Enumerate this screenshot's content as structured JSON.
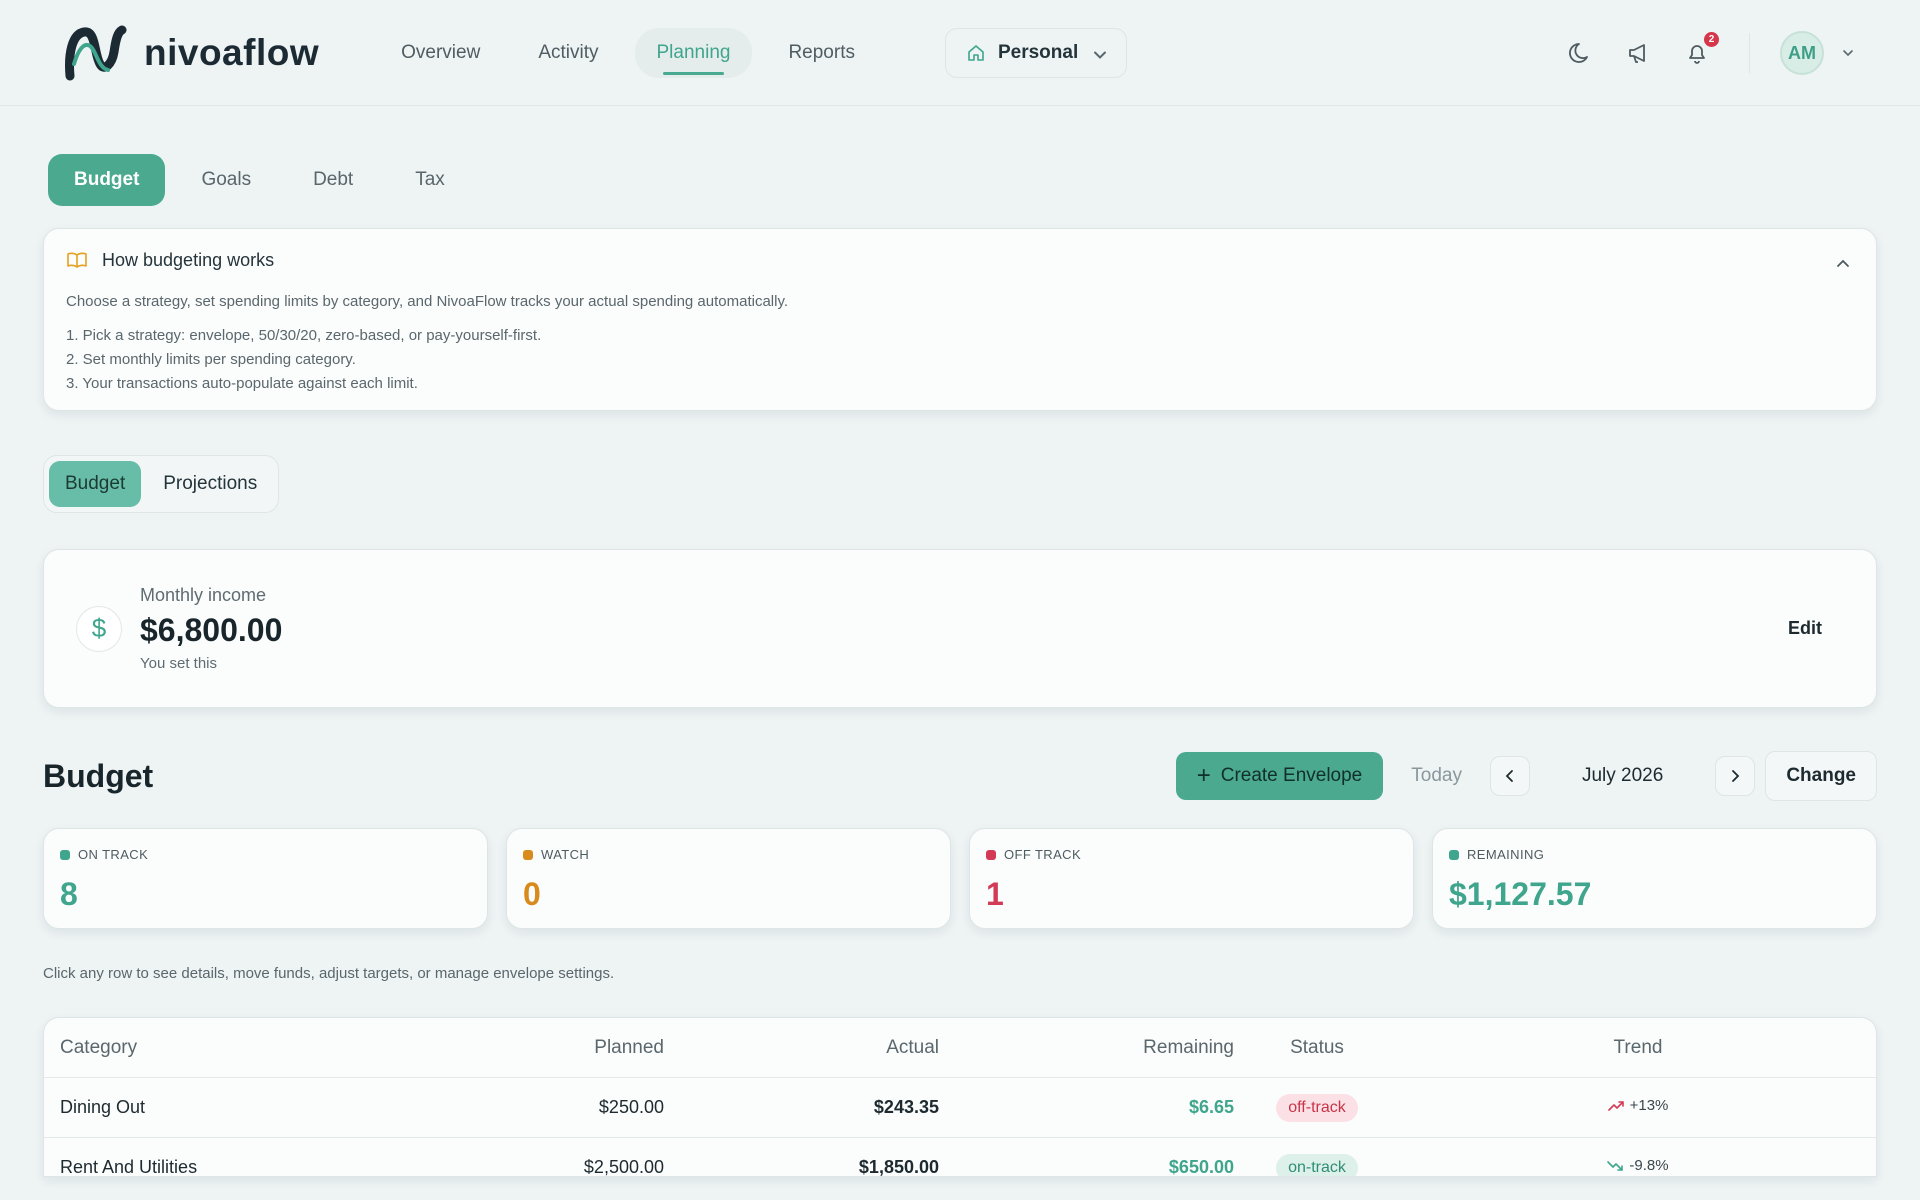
{
  "app": {
    "name": "nivoaflow"
  },
  "nav": {
    "items": [
      {
        "label": "Overview",
        "active": false
      },
      {
        "label": "Activity",
        "active": false
      },
      {
        "label": "Planning",
        "active": true
      },
      {
        "label": "Reports",
        "active": false
      }
    ]
  },
  "workspace": {
    "label": "Personal"
  },
  "header": {
    "notifications_count": "2",
    "avatar_initials": "AM"
  },
  "subtabs": [
    {
      "label": "Budget",
      "active": true
    },
    {
      "label": "Goals",
      "active": false
    },
    {
      "label": "Debt",
      "active": false
    },
    {
      "label": "Tax",
      "active": false
    }
  ],
  "howto": {
    "title": "How budgeting works",
    "description": "Choose a strategy, set spending limits by category, and NivoaFlow tracks your actual spending automatically.",
    "steps": [
      "1. Pick a strategy: envelope, 50/30/20, zero-based, or pay-yourself-first.",
      "2. Set monthly limits per spending category.",
      "3. Your transactions auto-populate against each limit."
    ]
  },
  "segment": {
    "items": [
      "Budget",
      "Projections"
    ],
    "active_index": 0
  },
  "income": {
    "label": "Monthly income",
    "value": "$6,800.00",
    "note": "You set this",
    "edit_label": "Edit"
  },
  "budget": {
    "title": "Budget",
    "create_label": "Create Envelope",
    "today_label": "Today",
    "month": "July 2026",
    "change_label": "Change",
    "stats": [
      {
        "label": "ON TRACK",
        "value": "8",
        "color": "#3fa58c"
      },
      {
        "label": "WATCH",
        "value": "0",
        "color": "#d98a1c"
      },
      {
        "label": "OFF TRACK",
        "value": "1",
        "color": "#d23a55"
      },
      {
        "label": "REMAINING",
        "value": "$1,127.57",
        "color": "#3fa58c"
      }
    ],
    "hint": "Click any row to see details, move funds, adjust targets, or manage envelope settings."
  },
  "table": {
    "headers": [
      "Category",
      "Planned",
      "Actual",
      "Remaining",
      "Status",
      "Trend"
    ],
    "rows": [
      {
        "category": "Dining Out",
        "planned": "$250.00",
        "actual": "$243.35",
        "remaining": "$6.65",
        "status": "off-track",
        "trend": "+13%",
        "trend_dir": "up"
      },
      {
        "category": "Rent And Utilities",
        "planned": "$2,500.00",
        "actual": "$1,850.00",
        "remaining": "$650.00",
        "status": "on-track",
        "trend": "-9.8%",
        "trend_dir": "down"
      }
    ]
  }
}
